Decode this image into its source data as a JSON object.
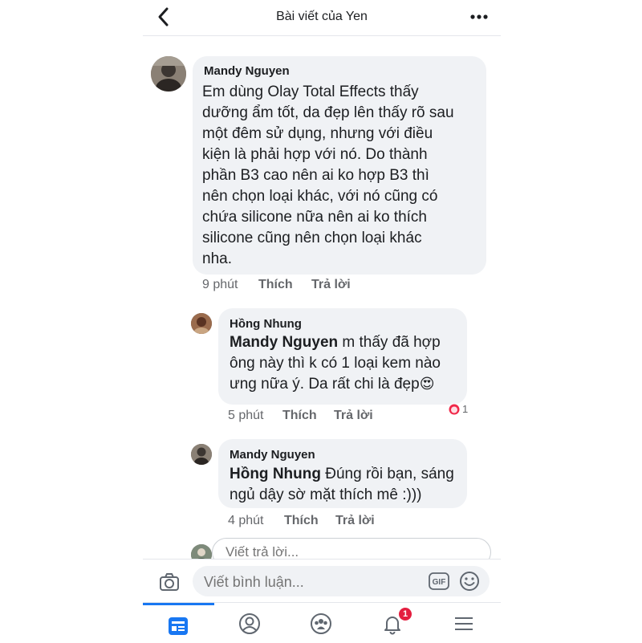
{
  "header": {
    "title": "Bài viết của Yen"
  },
  "comments": [
    {
      "author": "Mandy Nguyen",
      "lines": [
        "Em dùng Olay Total Effects thấy",
        "dưỡng ẩm tốt, da đẹp lên thấy rõ sau",
        "một đêm sử dụng, nhưng với điều",
        "kiện là phải hợp với nó. Do thành",
        "phần B3 cao nên ai ko hợp B3 thì",
        "nên chọn loại khác, với nó cũng có",
        "chứa silicone nữa nên ai ko thích",
        "silicone cũng nên chọn loại khác",
        "nha."
      ],
      "time": "9 phút",
      "like": "Thích",
      "reply": "Trả lời"
    },
    {
      "author": "Hồng Nhung",
      "mention": "Mandy Nguyen",
      "line1_rest": " m thấy đã hợp",
      "lines": [
        "ông này thì k có 1 loại kem nào",
        "ưng nữa ý. Da rất chi là đẹp"
      ],
      "emoji": "😍",
      "time": "5 phút",
      "like": "Thích",
      "reply": "Trả lời",
      "reaction_count": "1"
    },
    {
      "author": "Mandy Nguyen",
      "mention": "Hồng Nhung",
      "line1_rest": " Đúng rồi bạn, sáng",
      "lines": [
        "ngủ dậy sờ mặt thích mê :)))"
      ],
      "time": "4 phút",
      "like": "Thích",
      "reply": "Trả lời"
    }
  ],
  "reply_box": {
    "placeholder": "Viết trả lời..."
  },
  "composer": {
    "placeholder": "Viết bình luận...",
    "gif_label": "GIF"
  },
  "tabbar": {
    "notifications_badge": "1"
  },
  "colors": {
    "accent": "#1877f2",
    "bubble": "#f0f2f5",
    "badge": "#e41e3f",
    "secondary_text": "#65676b"
  },
  "icons": [
    "back-arrow-icon",
    "more-dots-icon",
    "camera-icon",
    "gif-icon",
    "emoji-icon",
    "news-feed-icon",
    "profile-icon",
    "groups-icon",
    "notifications-bell-icon",
    "menu-icon",
    "heart-eyes-reaction-icon"
  ]
}
